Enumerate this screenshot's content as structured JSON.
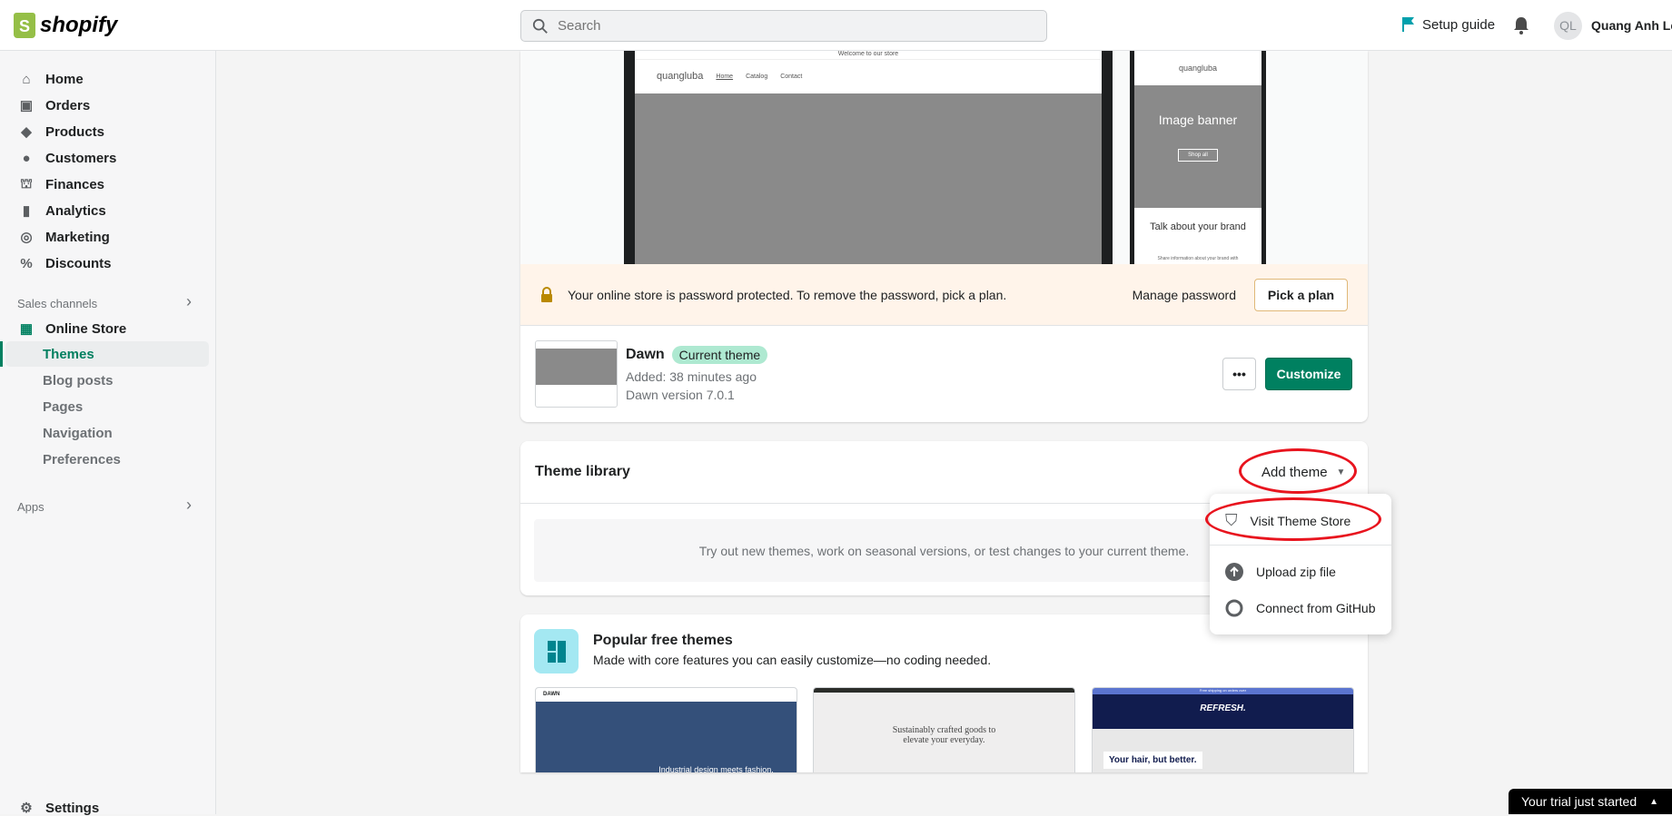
{
  "topbar": {
    "logo": "shopify",
    "search_placeholder": "Search",
    "setup_guide": "Setup guide",
    "avatar_initials": "QL",
    "user_name": "Quang Anh Lê"
  },
  "sidebar": {
    "items": [
      {
        "label": "Home"
      },
      {
        "label": "Orders"
      },
      {
        "label": "Products"
      },
      {
        "label": "Customers"
      },
      {
        "label": "Finances"
      },
      {
        "label": "Analytics"
      },
      {
        "label": "Marketing"
      },
      {
        "label": "Discounts"
      }
    ],
    "sales_channels": "Sales channels",
    "online_store": "Online Store",
    "sub_items": [
      "Themes",
      "Blog posts",
      "Pages",
      "Navigation",
      "Preferences"
    ],
    "apps": "Apps",
    "settings": "Settings"
  },
  "preview": {
    "announcement": "Welcome to our store",
    "store_name": "quangluba",
    "nav": [
      "Home",
      "Catalog",
      "Contact"
    ],
    "mobile_banner_title": "Image banner",
    "mobile_button": "Shop all",
    "mobile_heading": "Talk about your brand",
    "mobile_text": "Share information about your brand with"
  },
  "banner": {
    "text": "Your online store is password protected. To remove the password, pick a plan.",
    "manage": "Manage password",
    "pick_plan": "Pick a plan"
  },
  "current_theme": {
    "name": "Dawn",
    "badge": "Current theme",
    "added": "Added: 38 minutes ago",
    "version": "Dawn version 7.0.1",
    "more": "•••",
    "customize": "Customize"
  },
  "library": {
    "title": "Theme library",
    "add_theme": "Add theme",
    "empty_text": "Try out new themes, work on seasonal versions, or test changes to your current theme."
  },
  "dropdown": {
    "items": [
      "Visit Theme Store",
      "Upload zip file",
      "Connect from GitHub"
    ]
  },
  "popular": {
    "title": "Popular free themes",
    "subtitle": "Made with core features you can easily customize—no coding needed.",
    "thumbs": [
      {
        "brand": "DAWN",
        "caption": "Industrial design meets fashion."
      },
      {
        "caption": "Sustainably crafted goods to elevate your everyday."
      },
      {
        "announcement": "Free shipping on orders over",
        "brand": "REFRESH.",
        "caption": "Your hair, but better."
      }
    ]
  },
  "trial": {
    "label": "Your trial just started"
  },
  "colors": {
    "accent": "#008060",
    "highlight": "#e8141e",
    "banner_bg": "#fff4ea"
  }
}
